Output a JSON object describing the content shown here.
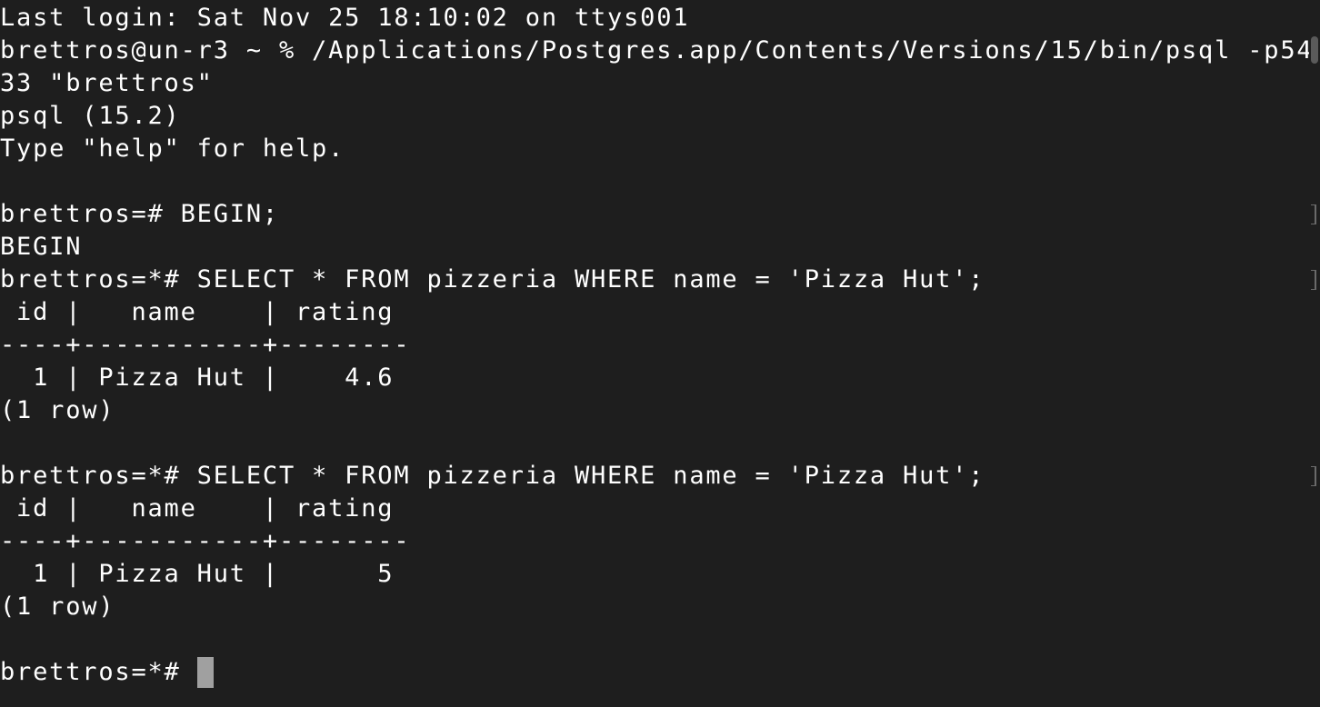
{
  "terminal": {
    "lines": [
      "Last login: Sat Nov 25 18:10:02 on ttys001",
      "brettros@un-r3 ~ % /Applications/Postgres.app/Contents/Versions/15/bin/psql -p54",
      "33 \"brettros\"",
      "psql (15.2)",
      "Type \"help\" for help.",
      "",
      "brettros=# BEGIN;",
      "BEGIN",
      "brettros=*# SELECT * FROM pizzeria WHERE name = 'Pizza Hut';",
      " id |   name    | rating",
      "----+-----------+--------",
      "  1 | Pizza Hut |    4.6",
      "(1 row)",
      "",
      "brettros=*# SELECT * FROM pizzeria WHERE name = 'Pizza Hut';",
      " id |   name    | rating",
      "----+-----------+--------",
      "  1 | Pizza Hut |      5",
      "(1 row)",
      "",
      "brettros=*# "
    ]
  },
  "colors": {
    "background": "#1e1e1e",
    "text": "#ffffff",
    "cursor": "#a0a0a0"
  }
}
